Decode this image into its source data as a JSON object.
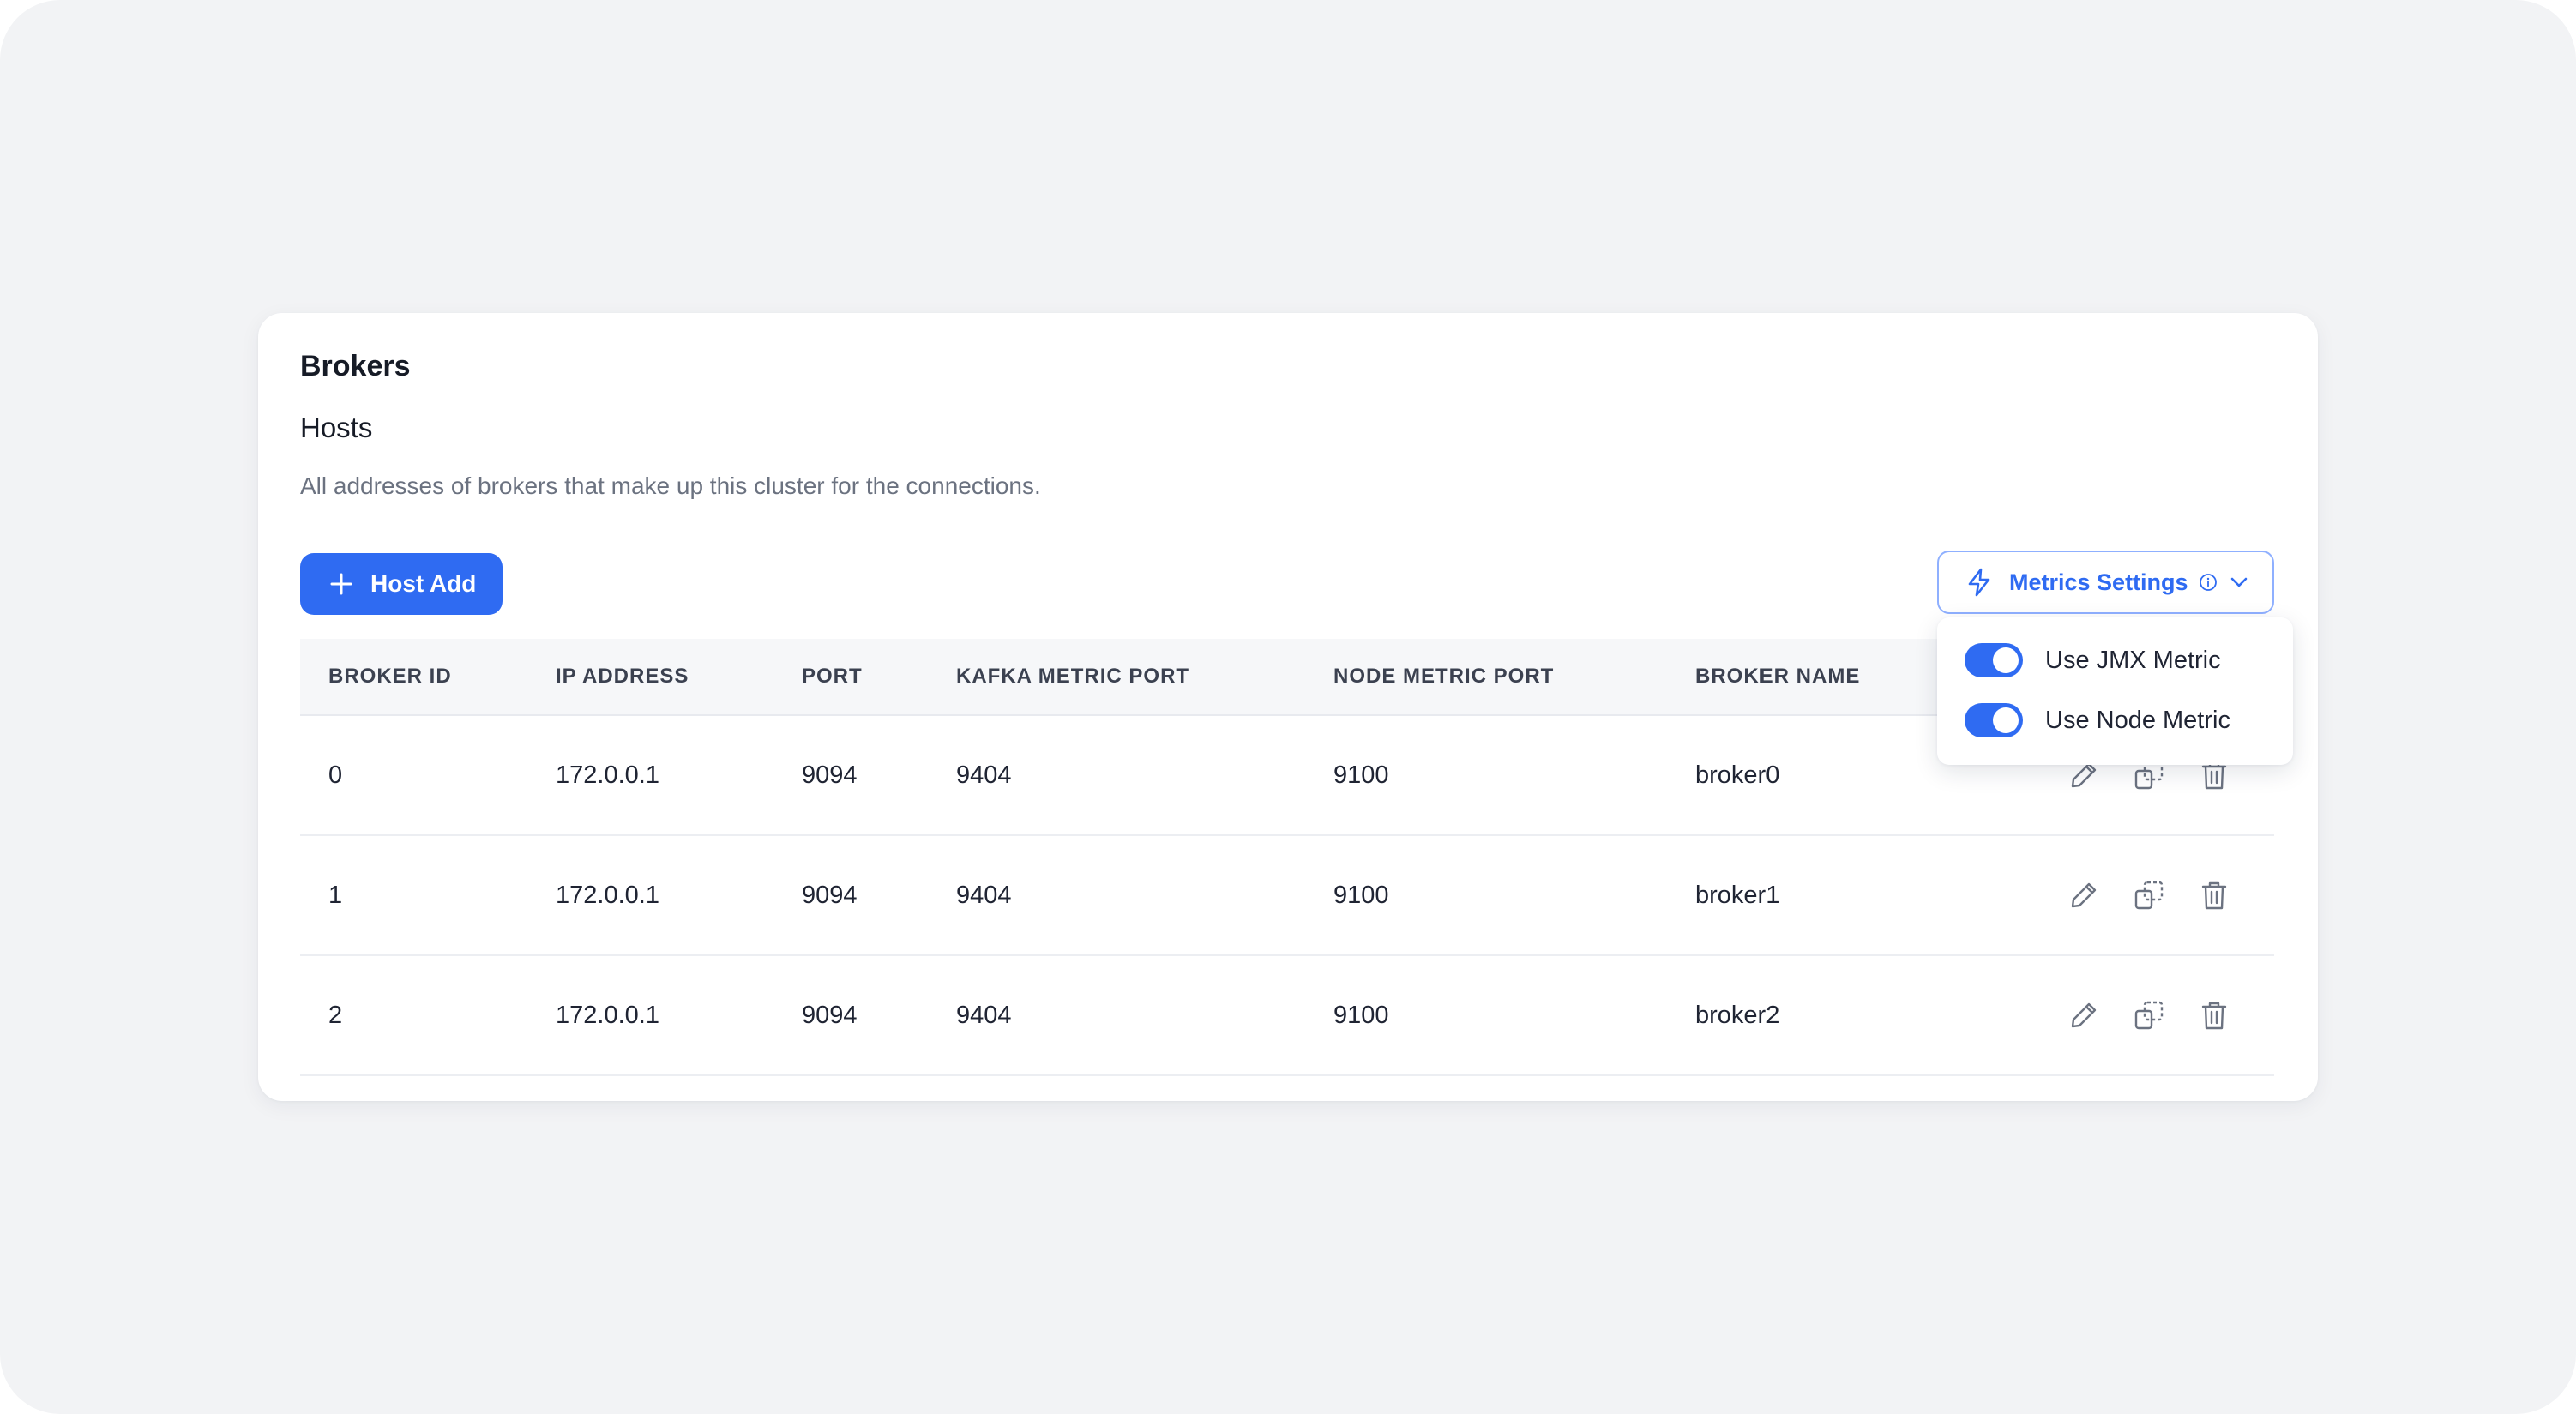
{
  "header": {
    "title": "Brokers",
    "subtitle": "Hosts",
    "description": "All addresses of brokers that make up this cluster for the connections."
  },
  "toolbar": {
    "add_label": "Host Add",
    "metrics_label": "Metrics Settings"
  },
  "metrics_menu": {
    "items": [
      {
        "label": "Use JMX Metric",
        "enabled": true
      },
      {
        "label": "Use Node Metric",
        "enabled": true
      }
    ]
  },
  "table": {
    "columns": [
      "BROKER ID",
      "IP ADDRESS",
      "PORT",
      "KAFKA METRIC PORT",
      "NODE METRIC PORT",
      "BROKER NAME"
    ],
    "rows": [
      [
        "0",
        "172.0.0.1",
        "9094",
        "9404",
        "9100",
        "broker0"
      ],
      [
        "1",
        "172.0.0.1",
        "9094",
        "9404",
        "9100",
        "broker1"
      ],
      [
        "2",
        "172.0.0.1",
        "9094",
        "9404",
        "9100",
        "broker2"
      ]
    ]
  },
  "icons": {
    "add": "plus-icon",
    "metrics": "lightning-bolt-icon",
    "info": "info-icon",
    "dropdown": "chevron-down-icon",
    "edit": "pencil-icon",
    "copy": "copy-icon",
    "delete": "trash-icon"
  },
  "colors": {
    "primary": "#2f6bf2",
    "background": "#f2f3f5",
    "card": "#ffffff",
    "muted_text": "#6b7280"
  }
}
